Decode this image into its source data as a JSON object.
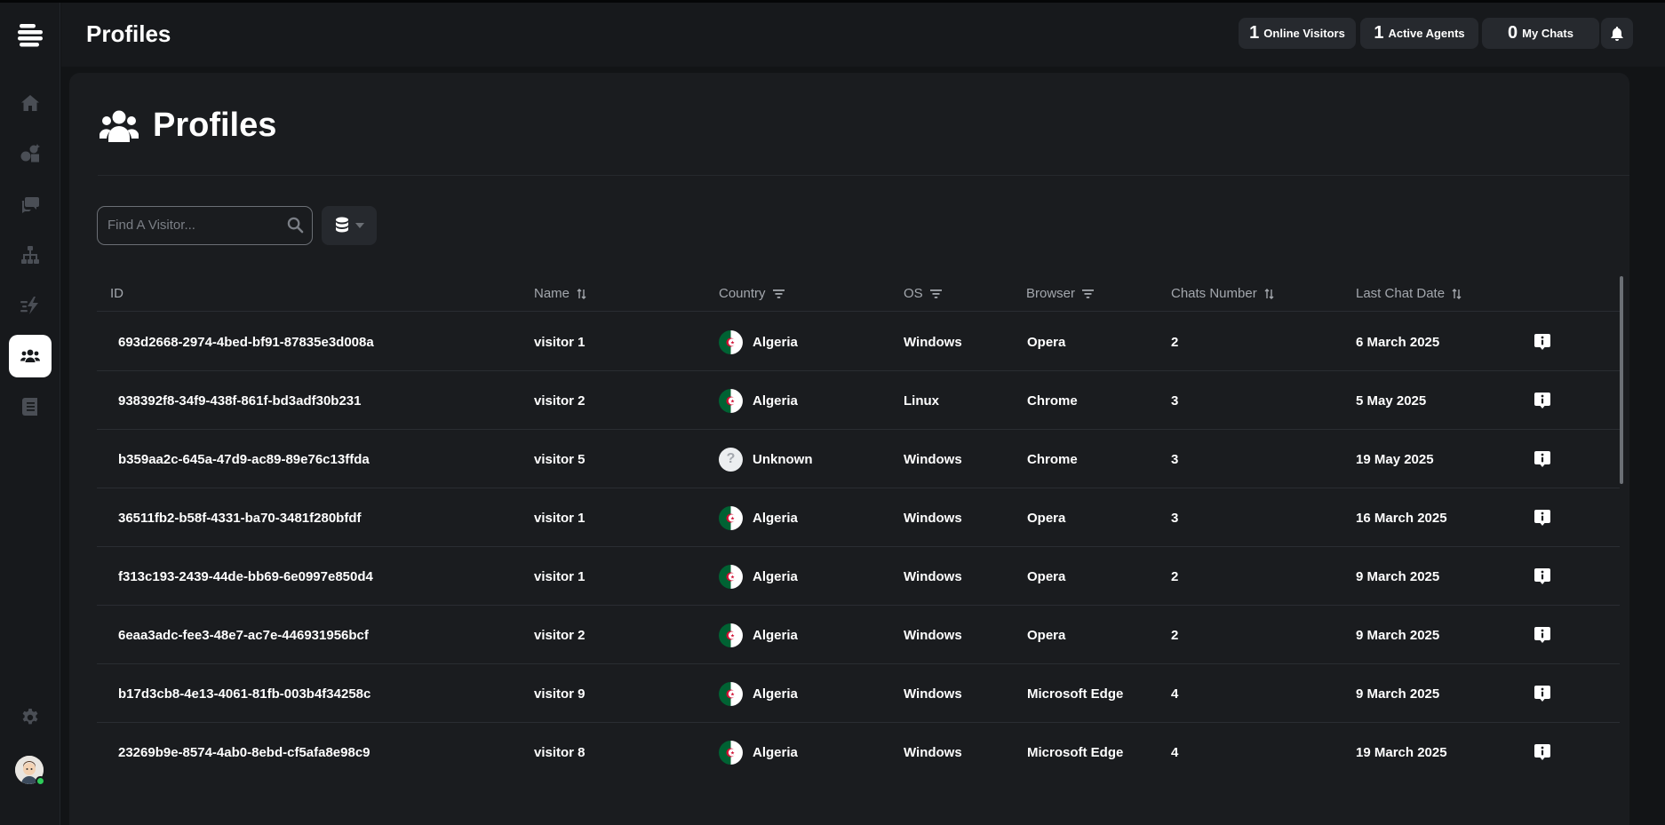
{
  "header": {
    "title": "Profiles",
    "stats": [
      {
        "value": "1",
        "label": "Online Visitors"
      },
      {
        "value": "1",
        "label": "Active Agents"
      },
      {
        "value": "0",
        "label": "My Chats"
      }
    ]
  },
  "sidebar": {
    "items": [
      {
        "icon": "home-icon"
      },
      {
        "icon": "shapes-icon"
      },
      {
        "icon": "chats-icon"
      },
      {
        "icon": "sitemap-icon"
      },
      {
        "icon": "bolt-icon"
      },
      {
        "icon": "users-icon",
        "active": true
      },
      {
        "icon": "document-icon"
      }
    ],
    "bottom": [
      {
        "icon": "gear-icon"
      },
      {
        "icon": "avatar"
      }
    ]
  },
  "page": {
    "title": "Profiles",
    "search_placeholder": "Find A Visitor..."
  },
  "table": {
    "columns": {
      "id": "ID",
      "name": "Name",
      "country": "Country",
      "os": "OS",
      "browser": "Browser",
      "chats": "Chats Number",
      "last_chat": "Last Chat Date"
    },
    "rows": [
      {
        "id": "693d2668-2974-4bed-bf91-87835e3d008a",
        "name": "visitor 1",
        "country": "Algeria",
        "os": "Windows",
        "browser": "Opera",
        "chats": "2",
        "last_chat": "6 March 2025"
      },
      {
        "id": "938392f8-34f9-438f-861f-bd3adf30b231",
        "name": "visitor 2",
        "country": "Algeria",
        "os": "Linux",
        "browser": "Chrome",
        "chats": "3",
        "last_chat": "5 May 2025"
      },
      {
        "id": "b359aa2c-645a-47d9-ac89-89e76c13ffda",
        "name": "visitor 5",
        "country": "Unknown",
        "os": "Windows",
        "browser": "Chrome",
        "chats": "3",
        "last_chat": "19 May 2025"
      },
      {
        "id": "36511fb2-b58f-4331-ba70-3481f280bfdf",
        "name": "visitor 1",
        "country": "Algeria",
        "os": "Windows",
        "browser": "Opera",
        "chats": "3",
        "last_chat": "16 March 2025"
      },
      {
        "id": "f313c193-2439-44de-bb69-6e0997e850d4",
        "name": "visitor 1",
        "country": "Algeria",
        "os": "Windows",
        "browser": "Opera",
        "chats": "2",
        "last_chat": "9 March 2025"
      },
      {
        "id": "6eaa3adc-fee3-48e7-ac7e-446931956bcf",
        "name": "visitor 2",
        "country": "Algeria",
        "os": "Windows",
        "browser": "Opera",
        "chats": "2",
        "last_chat": "9 March 2025"
      },
      {
        "id": "b17d3cb8-4e13-4061-81fb-003b4f34258c",
        "name": "visitor 9",
        "country": "Algeria",
        "os": "Windows",
        "browser": "Microsoft Edge",
        "chats": "4",
        "last_chat": "9 March 2025"
      },
      {
        "id": "23269b9e-8574-4ab0-8ebd-cf5afa8e98c9",
        "name": "visitor 8",
        "country": "Algeria",
        "os": "Windows",
        "browser": "Microsoft Edge",
        "chats": "4",
        "last_chat": "19 March 2025"
      }
    ]
  },
  "colors": {
    "background": "#121416",
    "panel": "#1a1c1f",
    "button": "#26292e",
    "online": "#2ecc5a",
    "algeria_green": "#006233",
    "algeria_red": "#d21034"
  }
}
